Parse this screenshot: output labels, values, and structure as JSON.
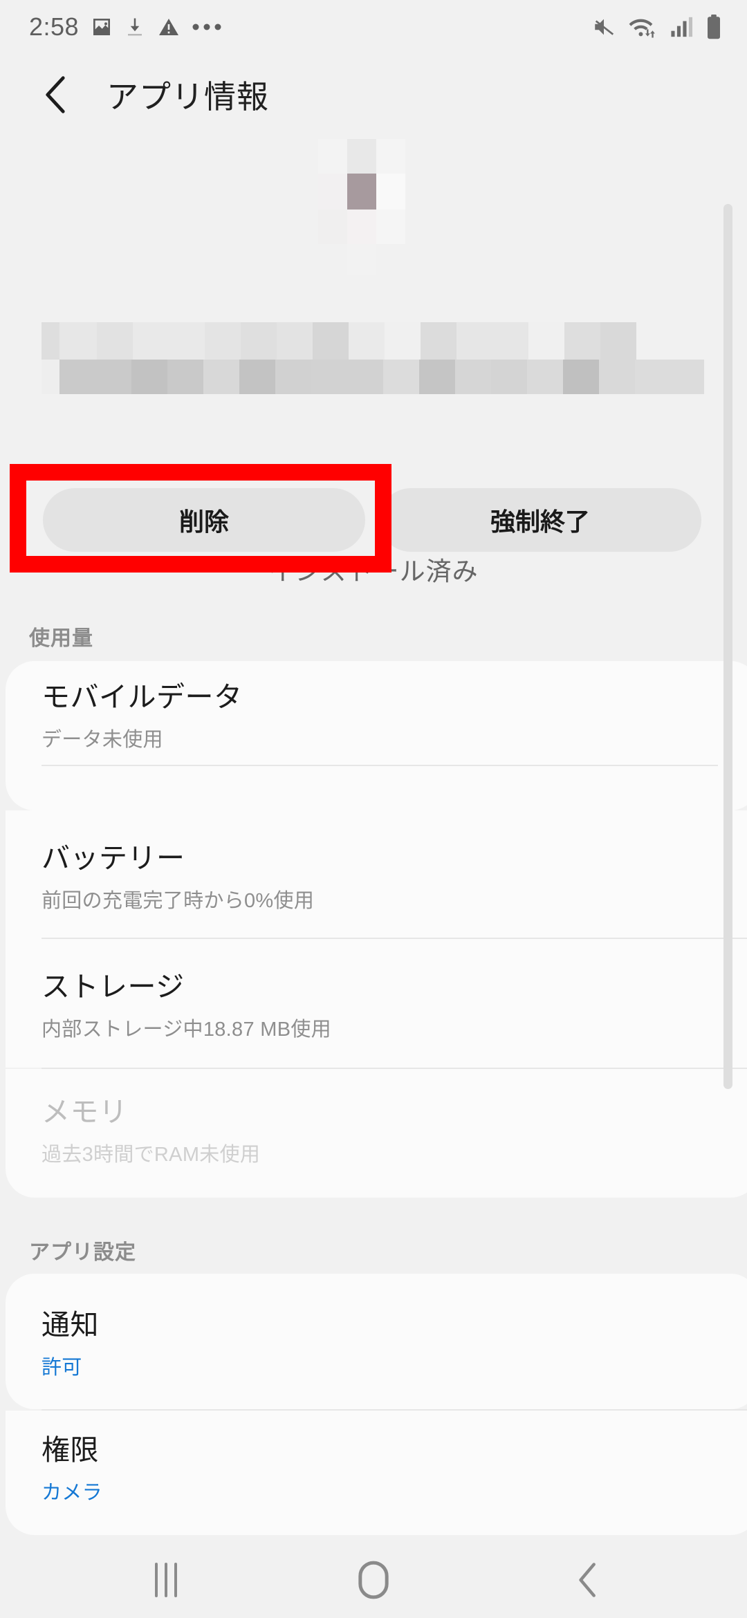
{
  "statusbar": {
    "time": "2:58",
    "left_icons": [
      "image-icon",
      "download-icon",
      "warning-icon",
      "more-overflow-icon"
    ],
    "right_icons": [
      "mute-icon",
      "wifi-data-icon",
      "signal-bars-icon",
      "battery-icon"
    ]
  },
  "header": {
    "title": "アプリ情報",
    "back_icon": "back-chevron-icon"
  },
  "app": {
    "icon": "censored-app-icon",
    "name": "censored-app-name",
    "status": "インストール済み"
  },
  "actions": {
    "uninstall_label": "削除",
    "force_stop_label": "強制終了",
    "highlight_color": "#ff0000",
    "highlight_target": "uninstall"
  },
  "sections": [
    {
      "label": "使用量",
      "rows": [
        {
          "title": "モバイルデータ",
          "sub": "データ未使用",
          "accent": false,
          "disabled": false
        },
        {
          "title": "バッテリー",
          "sub": "前回の充電完了時から0%使用",
          "accent": false,
          "disabled": false
        },
        {
          "title": "ストレージ",
          "sub": "内部ストレージ中18.87 MB使用",
          "accent": false,
          "disabled": false
        },
        {
          "title": "メモリ",
          "sub": "過去3時間でRAM未使用",
          "accent": false,
          "disabled": true
        }
      ]
    },
    {
      "label": "アプリ設定",
      "rows": [
        {
          "title": "通知",
          "sub": "許可",
          "accent": true,
          "disabled": false
        },
        {
          "title": "権限",
          "sub": "カメラ",
          "accent": true,
          "disabled": false
        }
      ]
    }
  ],
  "accent_color": "#1578d4",
  "scrollbar": {
    "color": "#dedede"
  },
  "navbar": {
    "recents_icon": "recents-icon",
    "home_icon": "home-icon",
    "back_icon": "nav-back-icon"
  }
}
